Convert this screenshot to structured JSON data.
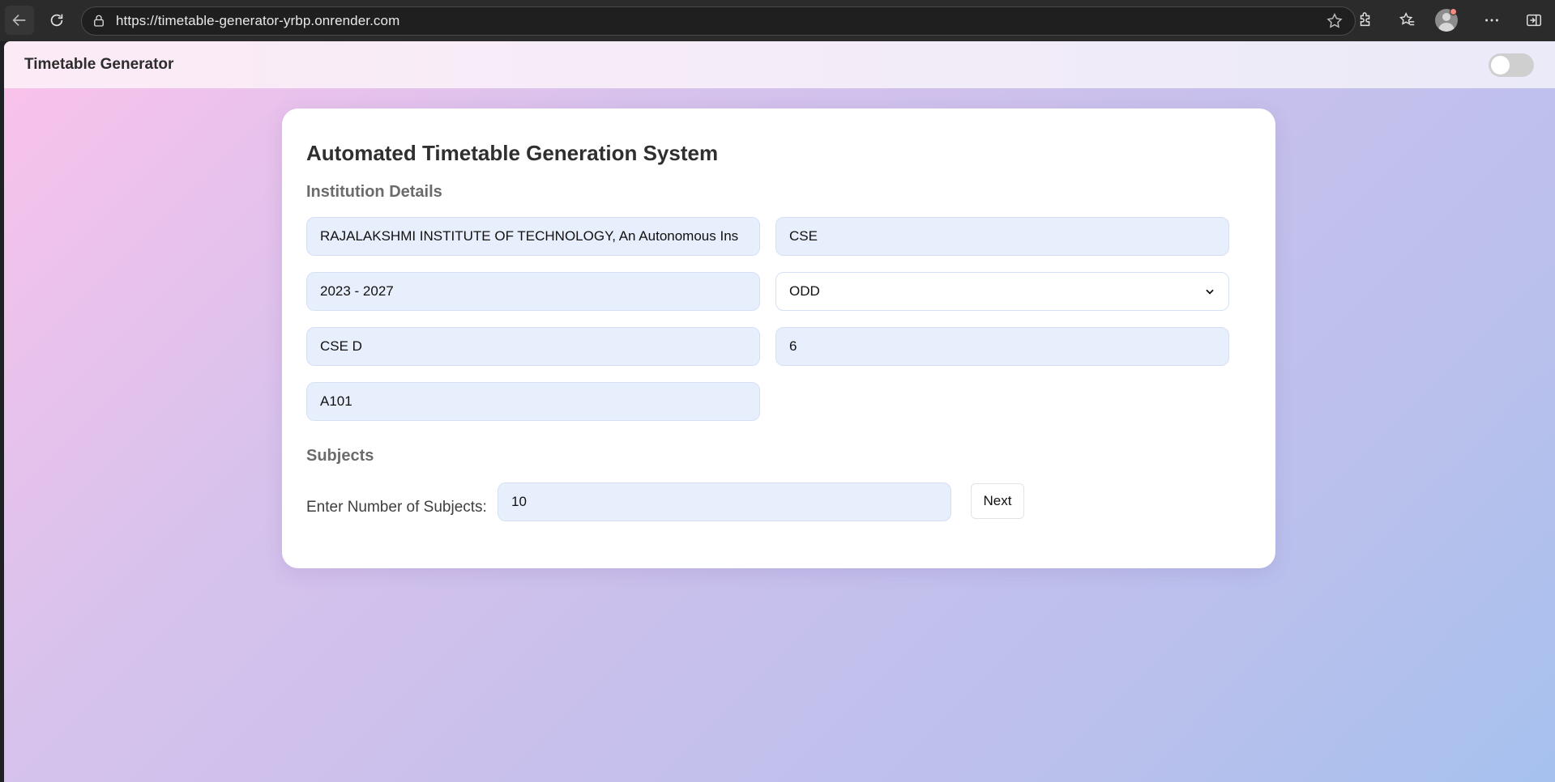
{
  "browser": {
    "url": "https://timetable-generator-yrbp.onrender.com"
  },
  "app": {
    "title": "Timetable Generator"
  },
  "form": {
    "title": "Automated Timetable Generation System",
    "institution_heading": "Institution Details",
    "institution_name": "RAJALAKSHMI INSTITUTE OF TECHNOLOGY, An Autonomous Ins",
    "department": "CSE",
    "batch": "2023 - 2027",
    "semester_type": "ODD",
    "section": "CSE D",
    "semester": "6",
    "room": "A101",
    "subjects_heading": "Subjects",
    "subjects_label": "Enter Number of Subjects:",
    "subjects_count": "10",
    "next_label": "Next"
  },
  "colors": {
    "input_bg": "#e8effc",
    "gradient_start": "#fbc2eb",
    "gradient_end": "#a6c1ee"
  }
}
